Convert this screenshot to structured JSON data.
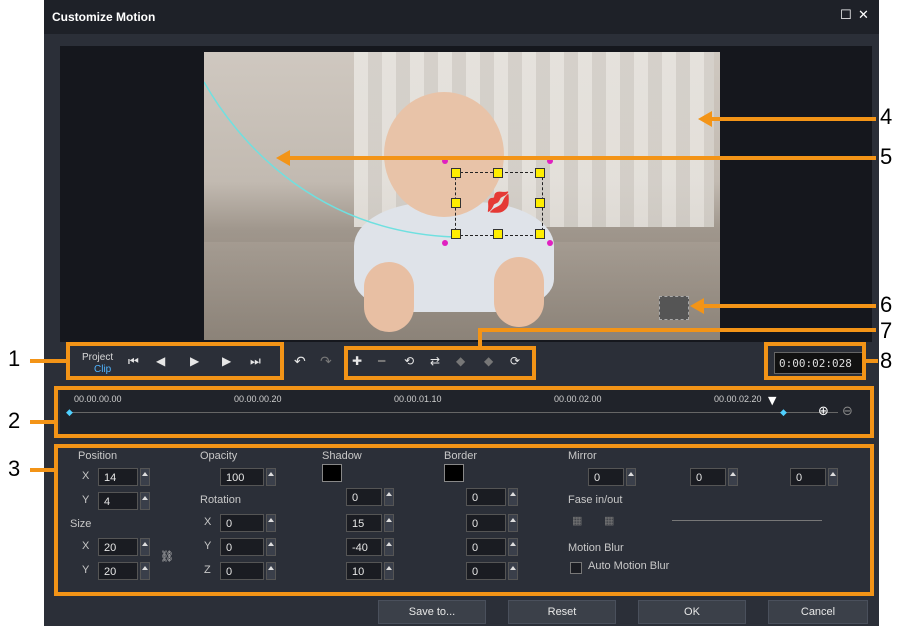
{
  "window": {
    "title": "Customize Motion"
  },
  "playback": {
    "project_label": "Project",
    "clip_label": "Clip",
    "timecode": "0:00:02:028"
  },
  "timeline": {
    "marks": [
      "00.00.00.00",
      "00.00.00.20",
      "00.00.01.10",
      "00.00.02.00",
      "00.00.02.20"
    ]
  },
  "position": {
    "title": "Position",
    "x": "14",
    "y": "4"
  },
  "size": {
    "title": "Size",
    "x": "20",
    "y": "20"
  },
  "opacity": {
    "title": "Opacity",
    "value": "100"
  },
  "rotation": {
    "title": "Rotation",
    "x": "0",
    "y": "0",
    "z": "0"
  },
  "shadow": {
    "title": "Shadow",
    "opacity": "0",
    "blur": "15",
    "angle": "-40",
    "distance": "10"
  },
  "border": {
    "title": "Border",
    "opacity": "0",
    "thickness": "0",
    "v1": "0",
    "v2": "0"
  },
  "mirror": {
    "title": "Mirror",
    "v1": "0",
    "v2": "0",
    "v3": "0"
  },
  "fade": {
    "title": "Fase in/out"
  },
  "blur": {
    "title": "Motion Blur",
    "auto": "Auto Motion Blur"
  },
  "buttons": {
    "save": "Save to...",
    "reset": "Reset",
    "ok": "OK",
    "cancel": "Cancel"
  },
  "callouts": [
    "1",
    "2",
    "3",
    "4",
    "5",
    "6",
    "7",
    "8"
  ]
}
